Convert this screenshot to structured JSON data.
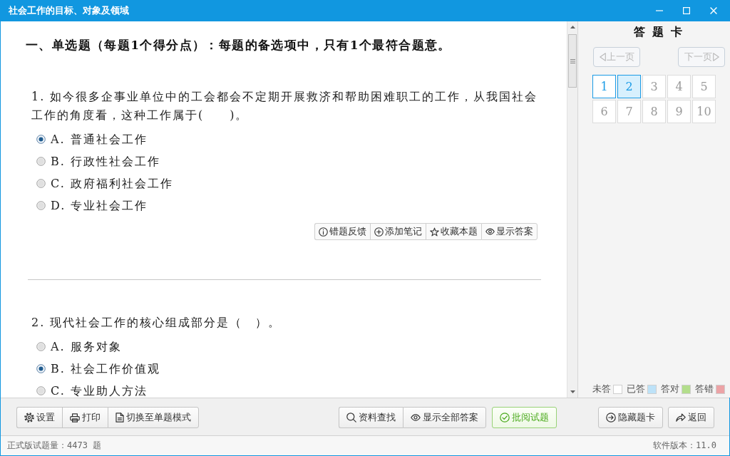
{
  "window": {
    "title": "社会工作的目标、对象及领域"
  },
  "section_heading": "一、单选题（每题1个得分点）：每题的备选项中，只有1个最符合题意。",
  "questions": [
    {
      "text": "1. 如今很多企事业单位中的工会都会不定期开展救济和帮助困难职工的工作，从我国社会工作的角度看，这种工作属于(　　)。",
      "options": [
        {
          "label": "A. 普通社会工作",
          "selected": true
        },
        {
          "label": "B. 行政性社会工作",
          "selected": false
        },
        {
          "label": "C. 政府福利社会工作",
          "selected": false
        },
        {
          "label": "D. 专业社会工作",
          "selected": false
        }
      ],
      "tools": [
        {
          "kind": "report",
          "label": "错题反馈"
        },
        {
          "kind": "note",
          "label": "添加笔记"
        },
        {
          "kind": "favorite",
          "label": "收藏本题"
        },
        {
          "kind": "answer",
          "label": "显示答案"
        }
      ]
    },
    {
      "text": "2. 现代社会工作的核心组成部分是（　）。",
      "options": [
        {
          "label": "A. 服务对象",
          "selected": false
        },
        {
          "label": "B. 社会工作价值观",
          "selected": true
        },
        {
          "label": "C. 专业助人方法",
          "selected": false
        }
      ]
    }
  ],
  "answer_card": {
    "title": "答 题 卡",
    "prev": {
      "label": "上一页",
      "disabled": true
    },
    "next": {
      "label": "下一页",
      "disabled": true
    },
    "cells": [
      {
        "label": "1",
        "answered": true,
        "selected": false
      },
      {
        "label": "2",
        "answered": true,
        "selected": true
      },
      {
        "label": "3",
        "answered": false,
        "selected": false
      },
      {
        "label": "4",
        "answered": false,
        "selected": false
      },
      {
        "label": "5",
        "answered": false,
        "selected": false
      },
      {
        "label": "6",
        "answered": false,
        "selected": false
      },
      {
        "label": "7",
        "answered": false,
        "selected": false
      },
      {
        "label": "8",
        "answered": false,
        "selected": false
      },
      {
        "label": "9",
        "answered": false,
        "selected": false
      },
      {
        "label": "10",
        "answered": false,
        "selected": false
      }
    ],
    "legend": [
      {
        "label": "未答",
        "color": "#ffffff"
      },
      {
        "label": "已答",
        "color": "#bde2f8"
      },
      {
        "label": "答对",
        "color": "#b3de8c"
      },
      {
        "label": "答错",
        "color": "#eca3a6"
      }
    ]
  },
  "toolbar": {
    "left": [
      [
        {
          "kind": "settings",
          "label": "设置"
        },
        {
          "kind": "print",
          "label": "打印"
        },
        {
          "kind": "mode",
          "label": "切换至单题模式"
        }
      ]
    ],
    "middle": [
      [
        {
          "kind": "search",
          "label": "资料查找"
        },
        {
          "kind": "show-answers",
          "label": "显示全部答案"
        }
      ],
      [
        {
          "kind": "review",
          "label": "批阅试题"
        }
      ]
    ],
    "right": [
      [
        {
          "kind": "hide-card",
          "label": "隐藏题卡"
        }
      ],
      [
        {
          "kind": "back",
          "label": "返回"
        }
      ]
    ]
  },
  "status_bar": {
    "question_count": "正式版试题量：4473 题",
    "version": "软件版本：11.0"
  }
}
